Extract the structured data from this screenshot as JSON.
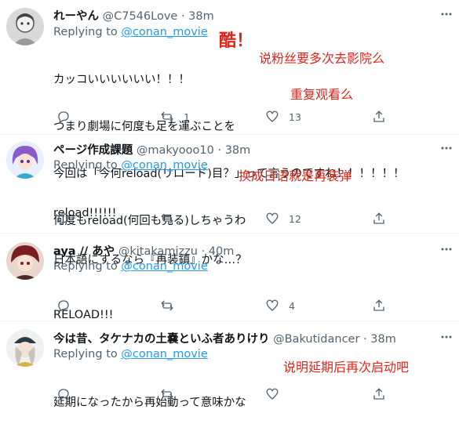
{
  "tweets": [
    {
      "name": "れーやん",
      "handle": "@C7546Love",
      "dot": "·",
      "time": "38m",
      "replying_prefix": "Replying to ",
      "replying_to": "@conan_movie",
      "lines": [
        "カッコいいいいいい！！！",
        "つまり劇場に何度も足を運ぶことを",
        "今回は「今何reload(リロード)目？」って言うのですね！！！！！！",
        "何度もreload(何回も見る)しちゃうわ"
      ],
      "replies": "",
      "retweets": "1",
      "likes": "13"
    },
    {
      "name": "ページ作成課題",
      "handle": "@makyooo10",
      "dot": "·",
      "time": "38m",
      "replying_prefix": "Replying to ",
      "replying_to": "@conan_movie",
      "lines": [
        "reload!!!!!!",
        "日本語にするなら『再装鎮』かな…？"
      ],
      "replies": "",
      "retweets": "",
      "likes": "12"
    },
    {
      "name": "aya // あや",
      "handle": "@kitakamizzu",
      "dot": "·",
      "time": "40m",
      "replying_prefix": "Replying to ",
      "replying_to": "@conan_movie",
      "lines": [
        "RELOAD!!!"
      ],
      "replies": "",
      "retweets": "",
      "likes": "4"
    },
    {
      "name": "今は昔、タケナカの土嚢といふ者ありけり",
      "handle": "@Bakutidancer",
      "dot": "·",
      "time": "38m",
      "replying_prefix": "Replying to ",
      "replying_to": "@conan_movie",
      "lines": [
        "延期になったから再始動って意味かな"
      ],
      "replies": "",
      "retweets": "",
      "likes": ""
    }
  ],
  "annotations": {
    "cool": "酷！",
    "fans_rewatch": "说粉丝要多次去影院么",
    "rewatch": "重复观看么",
    "reload_jp": "换成日语就是再装弹",
    "restart": "说明延期后再次启动吧"
  },
  "colors": {
    "accent": "#1d9bf0",
    "annotation": "#e0241b",
    "secondary_text": "#536471"
  }
}
